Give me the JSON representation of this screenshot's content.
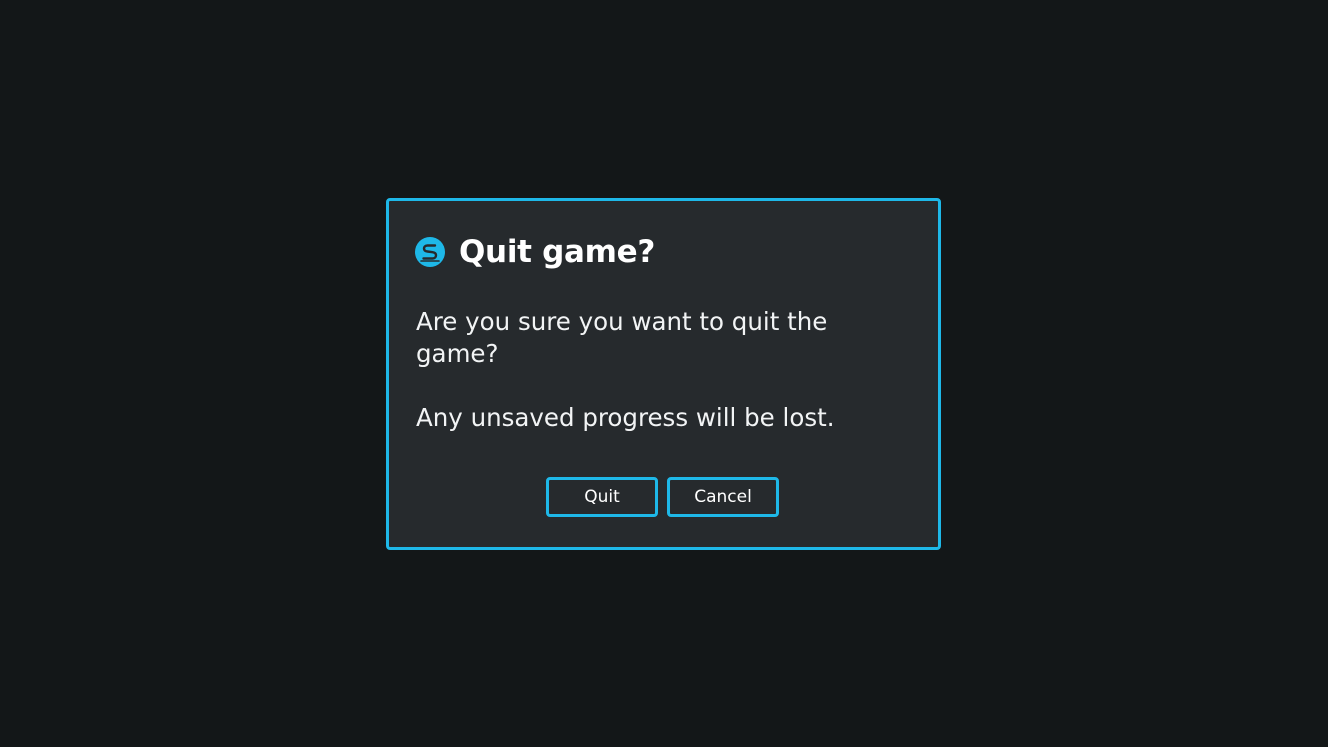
{
  "dialog": {
    "icon": "game-logo-icon",
    "title": "Quit game?",
    "message_line1": "Are you sure you want to quit the game?",
    "message_line2": "Any unsaved progress will be lost.",
    "quit_label": "Quit",
    "cancel_label": "Cancel"
  },
  "colors": {
    "background": "#131718",
    "dialog_background": "#262a2d",
    "accent": "#1eb8e8",
    "text": "#ffffff"
  }
}
